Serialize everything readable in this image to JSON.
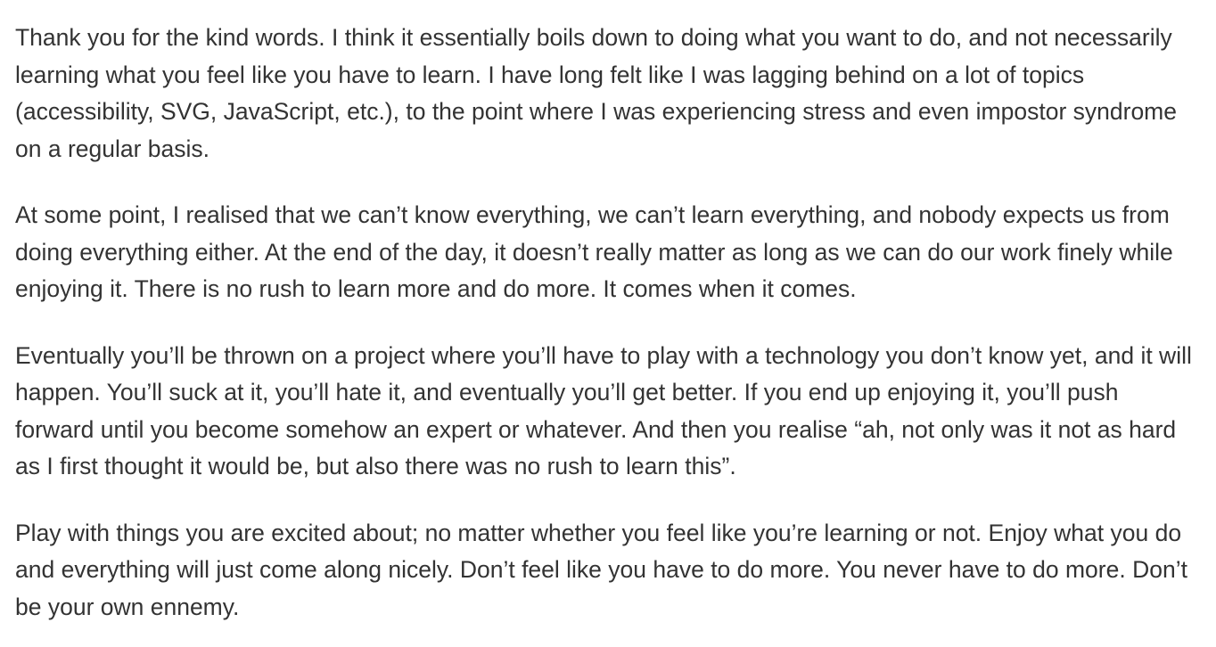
{
  "article": {
    "paragraphs": [
      "Thank you for the kind words. I think it essentially boils down to doing what you want to do, and not necessarily learning what you feel like you have to learn. I have long felt like I was lagging behind on a lot of topics (accessibility, SVG, JavaScript, etc.), to the point where I was experiencing stress and even impostor syndrome on a regular basis.",
      "At some point, I realised that we can’t know everything, we can’t learn everything, and nobody expects us from doing everything either. At the end of the day, it doesn’t really matter as long as we can do our work finely while enjoying it. There is no rush to learn more and do more. It comes when it comes.",
      "Eventually you’ll be thrown on a project where you’ll have to play with a technology you don’t know yet, and it will happen. You’ll suck at it, you’ll hate it, and eventually you’ll get better. If you end up enjoying it, you’ll push forward until you become somehow an expert or whatever. And then you realise “ah, not only was it not as hard as I first thought it would be, but also there was no rush to learn this”.",
      "Play with things you are excited about; no matter whether you feel like you’re learning or not. Enjoy what you do and everything will just come along nicely. Don’t feel like you have to do more. You never have to do more. Don’t be your own ennemy."
    ]
  },
  "colors": {
    "text": "#333333",
    "background": "#ffffff"
  }
}
